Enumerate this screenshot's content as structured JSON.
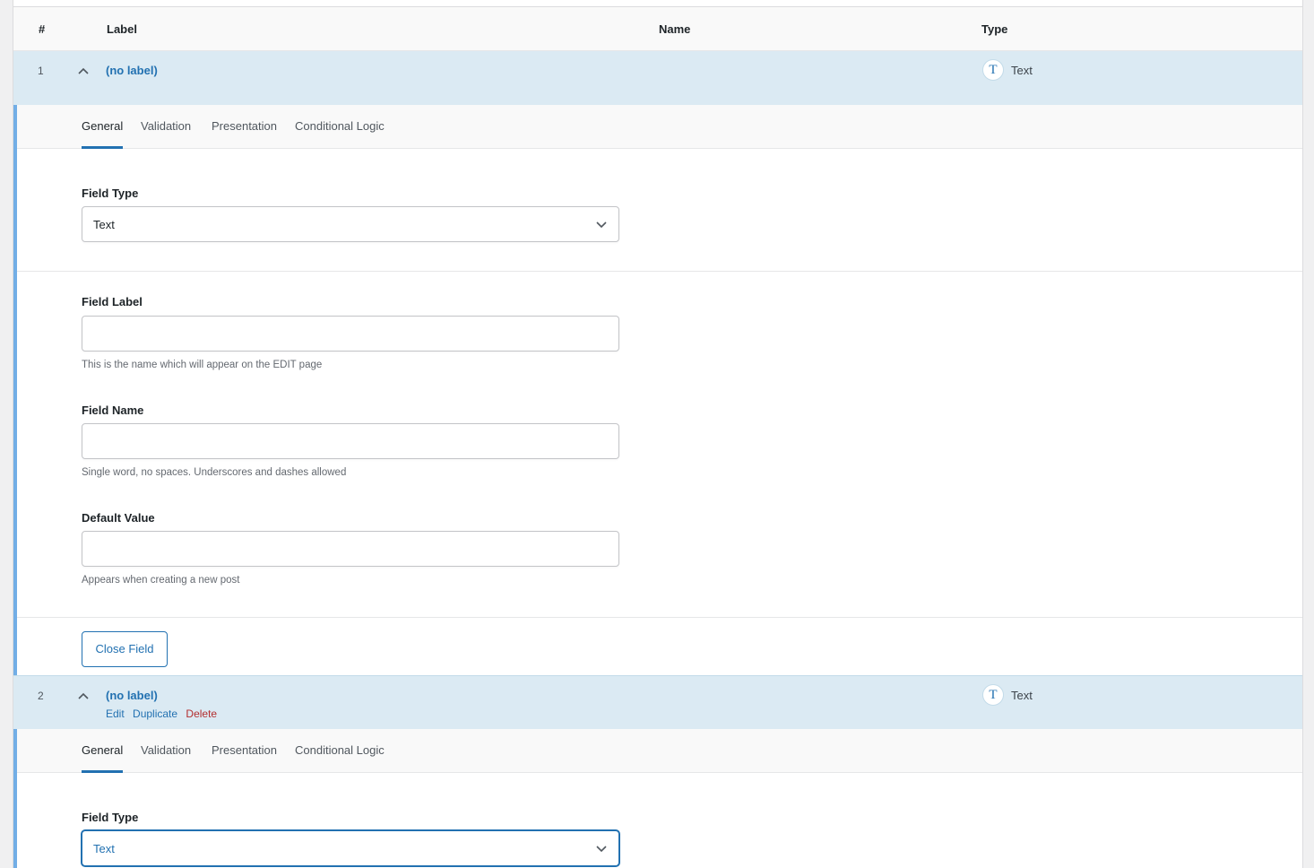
{
  "table_header": {
    "col_num": "#",
    "col_label": "Label",
    "col_name": "Name",
    "col_type": "Type"
  },
  "fields": [
    {
      "number": "1",
      "label": "(no label)",
      "type_icon": "text-type-icon",
      "type_icon_glyph": "T",
      "type": "Text",
      "tabs": [
        "General",
        "Validation",
        "Presentation",
        "Conditional Logic"
      ],
      "active_tab": "General",
      "field_type_label": "Field Type",
      "field_type_value": "Text",
      "field_label_label": "Field Label",
      "field_label_value": "",
      "field_label_help": "This is the name which will appear on the EDIT page",
      "field_name_label": "Field Name",
      "field_name_value": "",
      "field_name_help": "Single word, no spaces. Underscores and dashes allowed",
      "default_value_label": "Default Value",
      "default_value_value": "",
      "default_value_help": "Appears when creating a new post",
      "close_button": "Close Field"
    },
    {
      "number": "2",
      "label": "(no label)",
      "row_actions": {
        "edit": "Edit",
        "duplicate": "Duplicate",
        "delete": "Delete"
      },
      "type_icon": "text-type-icon",
      "type_icon_glyph": "T",
      "type": "Text",
      "tabs": [
        "General",
        "Validation",
        "Presentation",
        "Conditional Logic"
      ],
      "active_tab": "General",
      "field_type_label": "Field Type",
      "field_type_value": "Text"
    }
  ],
  "colors": {
    "accent": "#2271b1",
    "row_bg": "#dbeaf3",
    "delete": "#b32d2e",
    "open_bar": "#72aee6"
  }
}
